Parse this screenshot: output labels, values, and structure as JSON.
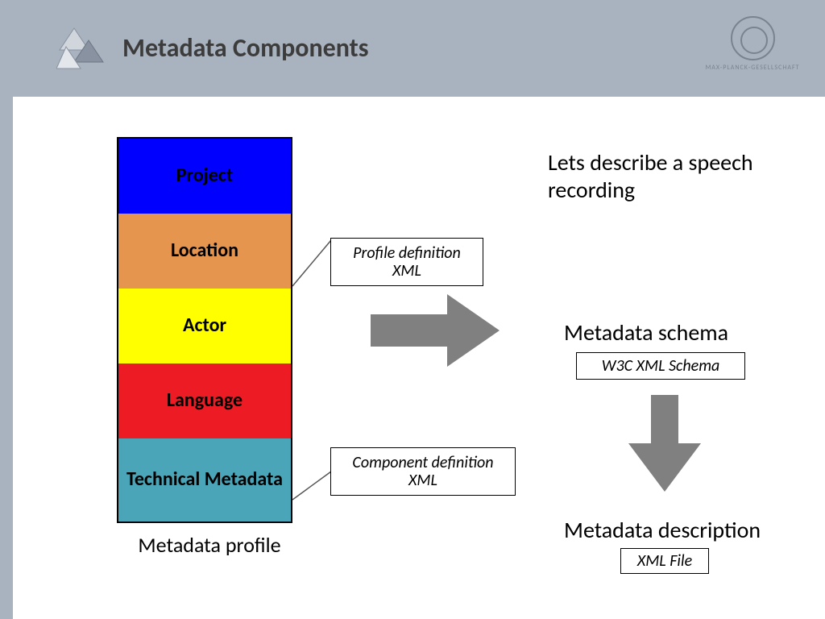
{
  "header": {
    "title": "Metadata Components",
    "org": "MAX-PLANCK-GESELLSCHAFT"
  },
  "stack": {
    "caption": "Metadata profile",
    "rows": [
      {
        "label": "Project",
        "color": "#0000ff"
      },
      {
        "label": "Location",
        "color": "#e6954e"
      },
      {
        "label": "Actor",
        "color": "#ffff00"
      },
      {
        "label": "Language",
        "color": "#ed1c24"
      },
      {
        "label": "Technical Metadata",
        "color": "#4aa5b8"
      }
    ]
  },
  "labels": {
    "profile_def": "Profile definition XML",
    "component_def": "Component definition XML",
    "w3c": "W3C XML Schema",
    "xmlfile": "XML File"
  },
  "right": {
    "intro": "Lets describe a speech recording",
    "schema": "Metadata schema",
    "description": "Metadata description"
  }
}
